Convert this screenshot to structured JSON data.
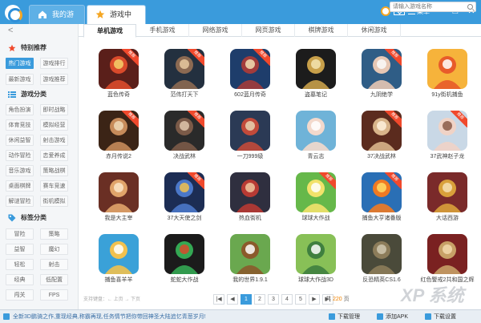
{
  "window": {
    "tabs": [
      {
        "label": "我的游戏"
      },
      {
        "label": "游戏中心"
      }
    ],
    "menu_label": "菜单",
    "controls": {
      "minimize": "—",
      "maximize": "□",
      "close": "✕"
    }
  },
  "sidebar": {
    "back": "<",
    "sections": [
      {
        "title": "特别推荐",
        "items": [
          "热门游戏",
          "游戏排行",
          "最新游戏",
          "游戏推荐"
        ]
      },
      {
        "title": "游戏分类",
        "items": [
          "角色扮演",
          "即时战略",
          "体育竞技",
          "模拟经营",
          "休闲益智",
          "射击游戏",
          "动作冒险",
          "恋爱养成",
          "音乐游戏",
          "策略战棋",
          "桌面棋牌",
          "赛车竞速",
          "解谜冒险",
          "街机模拟"
        ]
      },
      {
        "title": "标签分类",
        "items": [
          "冒险",
          "策略",
          "益智",
          "魔幻",
          "轻松",
          "射击",
          "经典",
          "低配置",
          "闯关",
          "FPS"
        ]
      }
    ]
  },
  "category_tabs": [
    "单机游戏",
    "手机游戏",
    "网络游戏",
    "网页游戏",
    "棋牌游戏",
    "休闲游戏"
  ],
  "search": {
    "placeholder": "请输入游戏名称"
  },
  "recommend_badge": "推荐",
  "games": [
    {
      "name": "蓝色传奇",
      "tag": true
    },
    {
      "name": "范伟打天下",
      "tag": true
    },
    {
      "name": "602蓝月传奇",
      "tag": true
    },
    {
      "name": "盗墓笔记",
      "tag": false
    },
    {
      "name": "九阴绝学",
      "tag": true
    },
    {
      "name": "91y街机捕鱼",
      "tag": false
    },
    {
      "name": "赤月传说2",
      "tag": true
    },
    {
      "name": "决战武林",
      "tag": true
    },
    {
      "name": "一刀999级",
      "tag": false
    },
    {
      "name": "青云志",
      "tag": false
    },
    {
      "name": "37决战武林",
      "tag": true
    },
    {
      "name": "37武神赵子龙",
      "tag": true
    },
    {
      "name": "我是大主宰",
      "tag": false
    },
    {
      "name": "37大天使之剑",
      "tag": true
    },
    {
      "name": "热血街机",
      "tag": false
    },
    {
      "name": "球球大作战",
      "tag": true
    },
    {
      "name": "捕鱼大亨诸番版",
      "tag": true
    },
    {
      "name": "大话西游",
      "tag": false
    },
    {
      "name": "捕鱼喜羊羊",
      "tag": false
    },
    {
      "name": "蛇蛇大作战",
      "tag": false
    },
    {
      "name": "我的世界1.9.1",
      "tag": false
    },
    {
      "name": "球球大作战3D",
      "tag": false
    },
    {
      "name": "反恐精英CS1.6",
      "tag": false
    },
    {
      "name": "红色警戒2共和国之辉",
      "tag": false
    }
  ],
  "pager": {
    "hint": "支持键盘：← 上页 → 下页",
    "pages": [
      "|◀",
      "◀",
      "1",
      "2",
      "3",
      "4",
      "5",
      "▶",
      "▶|"
    ],
    "current": "1",
    "total_prefix": "共",
    "total_count": "220",
    "total_suffix": "页",
    "watermark": "XP 系统之家"
  },
  "status": {
    "message": "全新3D鹏骑之作,重现经典,称霸再现,任务情节把你带回神圣大陆追忆青葱岁月!",
    "actions": [
      "下载管理",
      "添加APK",
      "下载设置"
    ]
  },
  "colors": {
    "accent": "#3a9bdc",
    "badge": "#f0492c",
    "total": "#f08300"
  }
}
